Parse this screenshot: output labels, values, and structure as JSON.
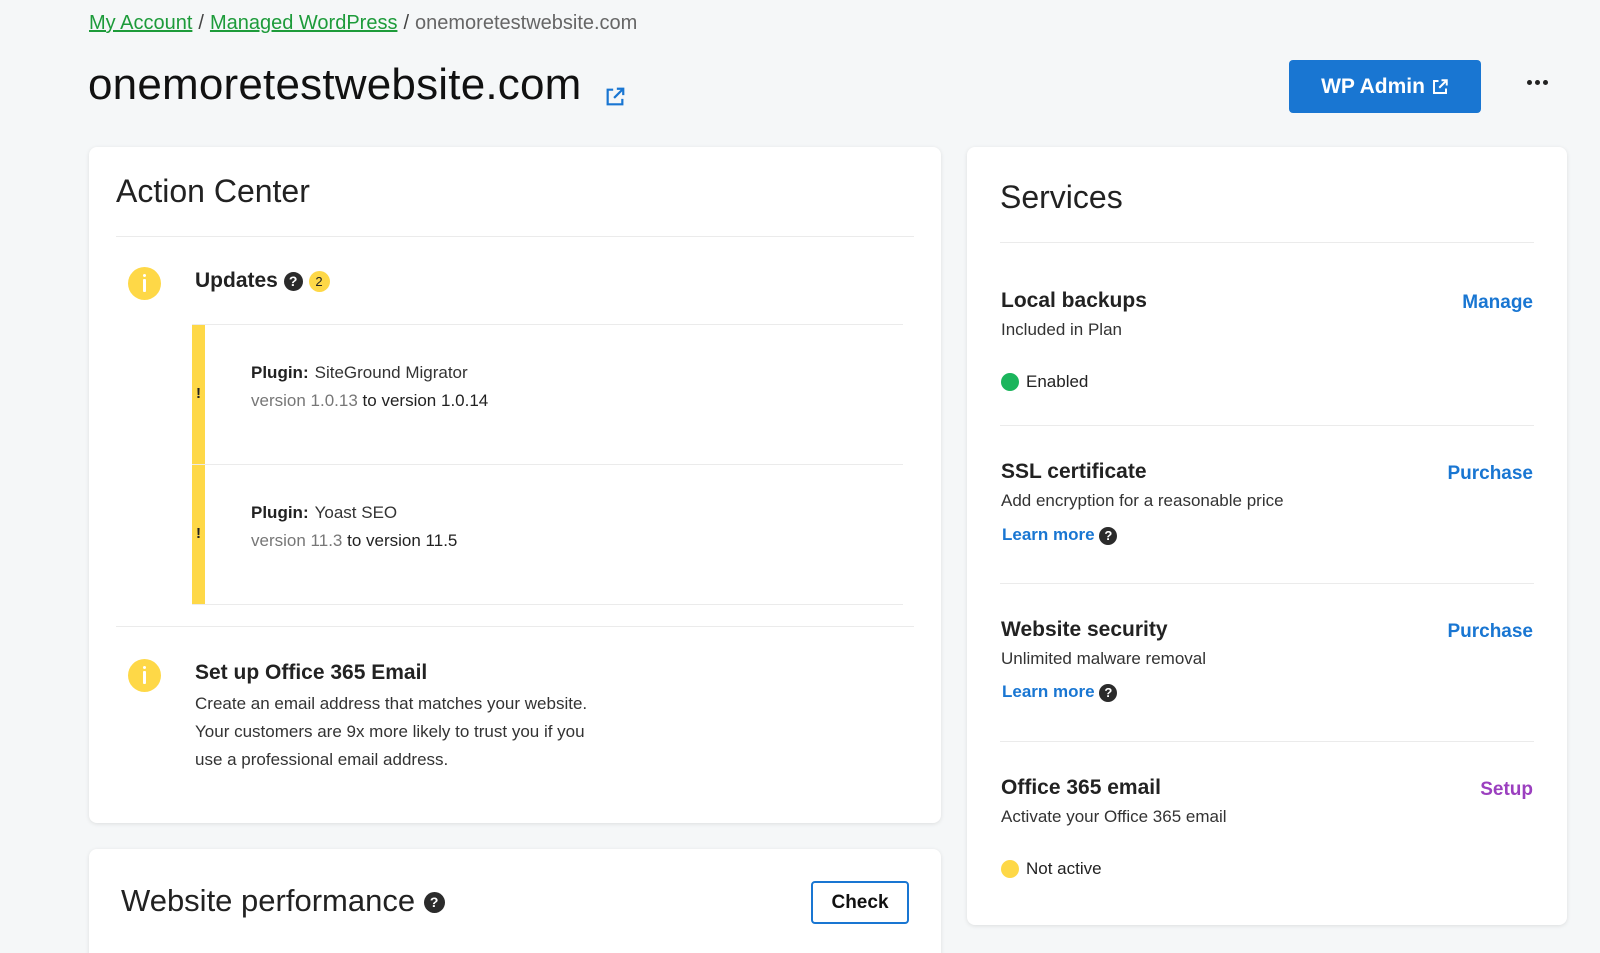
{
  "breadcrumb": {
    "items": [
      "My Account",
      "Managed WordPress"
    ],
    "separator": "/",
    "current": "onemoretestwebsite.com"
  },
  "header": {
    "title": "onemoretestwebsite.com",
    "wp_admin_label": "WP Admin",
    "accent_color": "#1976d2"
  },
  "action_center": {
    "title": "Action Center",
    "updates": {
      "title": "Updates",
      "help": "?",
      "count": "2",
      "items": [
        {
          "label": "Plugin:",
          "name": "SiteGround Migrator",
          "version_prefix": "version",
          "from_version": "1.0.13",
          "to_text": "to version",
          "to_version": "1.0.14",
          "flag": "!"
        },
        {
          "label": "Plugin:",
          "name": "Yoast SEO",
          "version_prefix": "version",
          "from_version": "11.3",
          "to_text": "to version",
          "to_version": "11.5",
          "flag": "!"
        }
      ]
    },
    "office": {
      "title": "Set up Office 365 Email",
      "lines": [
        "Create an email address that matches your website.",
        "Your customers are 9x more likely to trust you if you",
        "use a professional email address."
      ]
    }
  },
  "performance": {
    "title": "Website performance",
    "help": "?",
    "check_label": "Check"
  },
  "services": {
    "title": "Services",
    "items": [
      {
        "title": "Local backups",
        "desc": "Included in Plan",
        "action": "Manage",
        "status": "Enabled",
        "status_color": "#1bb55c"
      },
      {
        "title": "SSL certificate",
        "desc": "Add encryption for a reasonable price",
        "action": "Purchase",
        "learn_more": "Learn more",
        "help": "?"
      },
      {
        "title": "Website security",
        "desc": "Unlimited malware removal",
        "action": "Purchase",
        "learn_more": "Learn more",
        "help": "?"
      },
      {
        "title": "Office 365 email",
        "desc": "Activate your Office 365 email",
        "action": "Setup",
        "action_color": "#9b3fbf",
        "status": "Not active",
        "status_color": "#fed847"
      }
    ]
  }
}
